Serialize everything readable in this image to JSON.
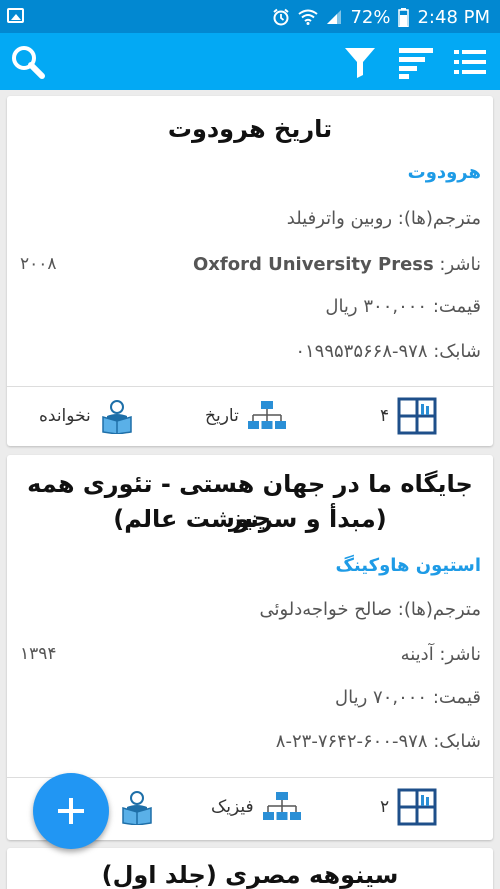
{
  "status_bar": {
    "battery_percent": "72%",
    "time": "2:48 PM",
    "icons": [
      "image-icon",
      "alarm-icon",
      "wifi-icon",
      "signal-icon",
      "battery-icon"
    ]
  },
  "app_bar": {
    "icons": [
      "search-icon",
      "filter-icon",
      "sort-icon",
      "list-view-icon"
    ],
    "accent_color": "#03a9f4",
    "status_color": "#0288d1"
  },
  "books": [
    {
      "title": "تاریخ هرودوت",
      "author": "هرودوت",
      "translator": "مترجم(ها): روبین واترفیلد",
      "publisher_label": "ناشر: ",
      "publisher_name": "Oxford University Press",
      "year": "۲۰۰۸",
      "price": "قیمت: ۳۰۰,۰۰۰ ریال",
      "isbn": "شابک: ۹۷۸-۰۱۹۹۵۳۵۶۶۸",
      "status": "نخوانده",
      "category": "تاریخ",
      "shelf": "۴"
    },
    {
      "title_line1": "جایگاه ما در جهان هستی - تئوری همه چیز",
      "title_line2": "(مبدأ و سرنوشت عالم)",
      "author": "استیون هاوکینگ",
      "translator": "مترجم(ها): صالح خواجه‌دلوئی",
      "publisher_label": "ناشر: آدینه",
      "year": "۱۳۹۴",
      "price": "قیمت: ۷۰,۰۰۰ ریال",
      "isbn": "شابک: ۹۷۸-۶۰۰-۷۶۴۲-۲۳-۸",
      "category": "فیزیک",
      "shelf": "۲"
    },
    {
      "title": "سینوهه مصری (جلد اول)"
    }
  ],
  "fab": {
    "icon": "add-icon",
    "color": "#2196f3"
  }
}
